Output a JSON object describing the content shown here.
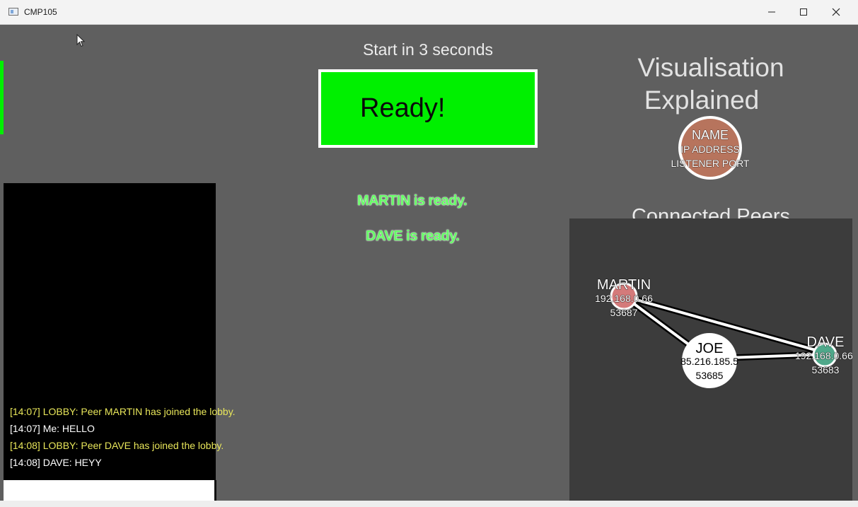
{
  "window": {
    "title": "CMP105"
  },
  "header": {
    "start_text": "Start in 3 seconds"
  },
  "ready_button": {
    "label": "Ready!",
    "color": "#00f000"
  },
  "statuses": [
    "MARTIN is ready.",
    "DAVE is ready."
  ],
  "visualisation": {
    "title_line1": "Visualisation",
    "title_line2": "Explained",
    "legend": {
      "name": "NAME",
      "ip": "IP ADDRESS",
      "port": "LISTENER PORT"
    }
  },
  "peers": {
    "title": "Connected Peers",
    "nodes": [
      {
        "name": "MARTIN",
        "ip": "192.168.0.66",
        "port": "53687",
        "color": "#d47a7a"
      },
      {
        "name": "JOE",
        "ip": "85.216.185.5",
        "port": "53685",
        "color": "#ffffff"
      },
      {
        "name": "DAVE",
        "ip": "192.168.0.66",
        "port": "53683",
        "color": "#4fa88a"
      }
    ]
  },
  "chat": {
    "messages": [
      {
        "text": "[14:07] LOBBY: Peer MARTIN has joined the lobby.",
        "color": "#e8e65a"
      },
      {
        "text": "[14:07] Me: HELLO",
        "color": "#ffffff"
      },
      {
        "text": "[14:08] LOBBY: Peer DAVE has joined the lobby.",
        "color": "#e8e65a"
      },
      {
        "text": "[14:08] DAVE: HEYY",
        "color": "#ffffff"
      }
    ],
    "input_value": ""
  }
}
